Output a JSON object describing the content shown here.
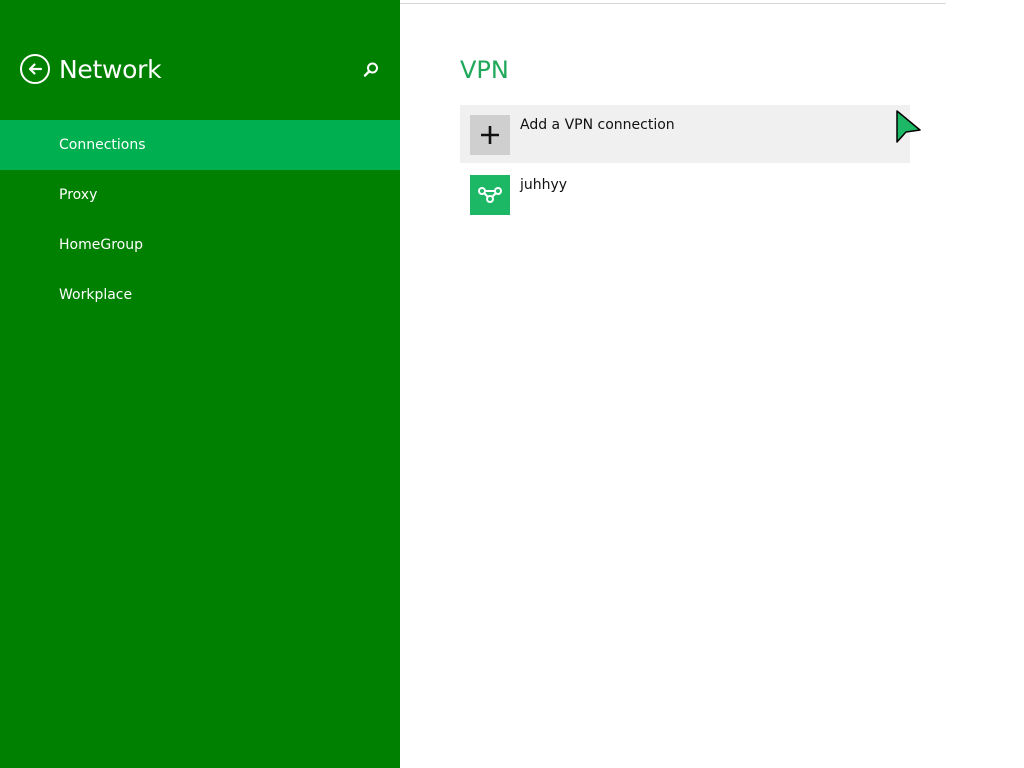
{
  "sidebar": {
    "title": "Network",
    "back_icon": "back-arrow-icon",
    "search_icon": "search-icon",
    "items": [
      {
        "label": "Connections",
        "active": true
      },
      {
        "label": "Proxy",
        "active": false
      },
      {
        "label": "HomeGroup",
        "active": false
      },
      {
        "label": "Workplace",
        "active": false
      }
    ]
  },
  "main": {
    "section_title": "VPN",
    "add_connection": {
      "label": "Add a VPN connection",
      "icon": "plus-icon"
    },
    "connections": [
      {
        "name": "juhhyy",
        "icon": "vpn-connection-icon"
      }
    ]
  },
  "colors": {
    "sidebar_bg": "#008000",
    "active_item": "#00b050",
    "accent_title": "#1fa85a",
    "vpn_tile": "#1db865"
  }
}
